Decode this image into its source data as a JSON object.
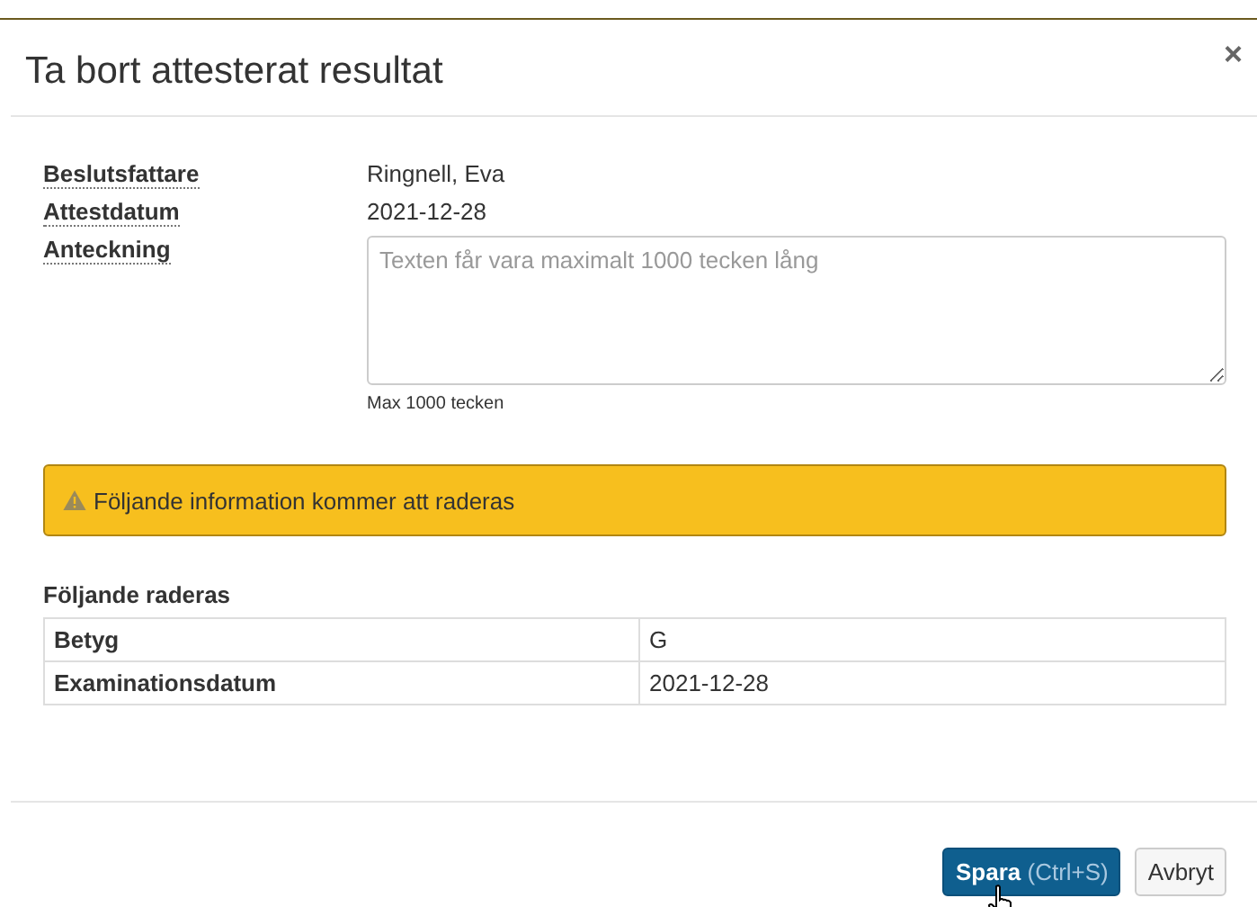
{
  "dialog": {
    "title": "Ta bort attesterat resultat",
    "close": "×"
  },
  "fields": [
    {
      "label": "Beslutsfattare",
      "value": "Ringnell, Eva",
      "kind": "text"
    },
    {
      "label": "Attestdatum",
      "value": "2021-12-28",
      "kind": "text"
    },
    {
      "label": "Anteckning",
      "placeholder": "Texten får vara maximalt 1000 tecken lång",
      "hint": "Max 1000 tecken",
      "kind": "textarea"
    }
  ],
  "alert": {
    "text": "Följande information kommer att raderas"
  },
  "deleted": {
    "heading": "Följande raderas",
    "rows": [
      {
        "label": "Betyg",
        "value": "G"
      },
      {
        "label": "Examinationsdatum",
        "value": "2021-12-28"
      }
    ]
  },
  "buttons": [
    {
      "label": "Spara",
      "shortcut": "(Ctrl+S)",
      "kind": "primary"
    },
    {
      "label": "Avbryt",
      "kind": "default"
    }
  ]
}
